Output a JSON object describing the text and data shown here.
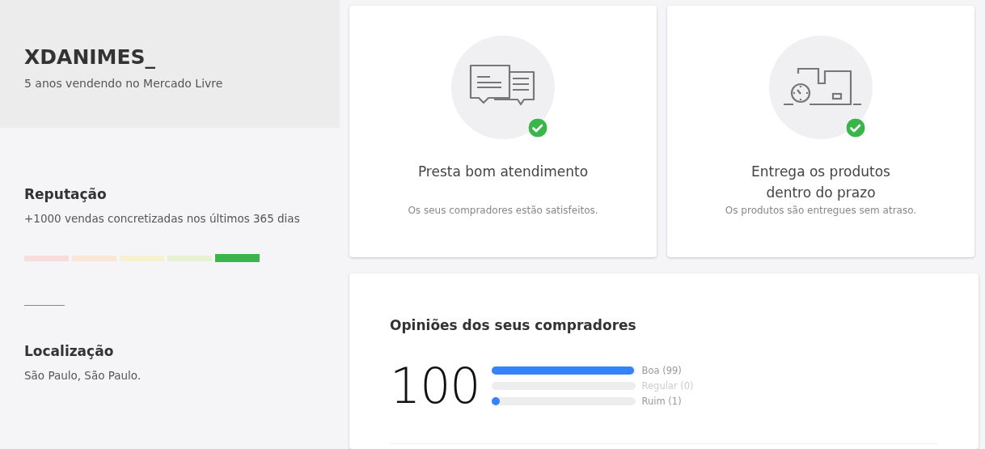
{
  "seller": {
    "name": "XDANIMES_",
    "tenure": "5 anos vendendo no Mercado Livre"
  },
  "reputation": {
    "title": "Reputação",
    "sales": "+1000 vendas concretizadas nos últimos 365 dias",
    "segments": [
      {
        "color": "#f8dcdc",
        "active": false
      },
      {
        "color": "#f9e6d6",
        "active": false
      },
      {
        "color": "#f8f1cf",
        "active": false
      },
      {
        "color": "#e8f2d2",
        "active": false
      },
      {
        "color": "#39b54a",
        "active": true
      }
    ]
  },
  "location": {
    "title": "Localização",
    "value": "São Paulo, São Paulo."
  },
  "metrics": [
    {
      "kind": "chat",
      "title": "Presta bom atendimento",
      "description": "Os seus compradores estão satisfeitos.",
      "achieved": true
    },
    {
      "kind": "delivery",
      "title": "Entrega os produtos dentro do prazo",
      "description": "Os produtos são entregues sem atraso.",
      "achieved": true
    }
  ],
  "opinions": {
    "title": "Opiniões dos seus compradores",
    "score": "100",
    "ratings": [
      {
        "label": "Boa (99)",
        "level": 0.99,
        "muted": false
      },
      {
        "label": "Regular (0)",
        "muted": true
      },
      {
        "label": "Ruim (1)",
        "level": 0.01,
        "muted": false
      }
    ]
  }
}
